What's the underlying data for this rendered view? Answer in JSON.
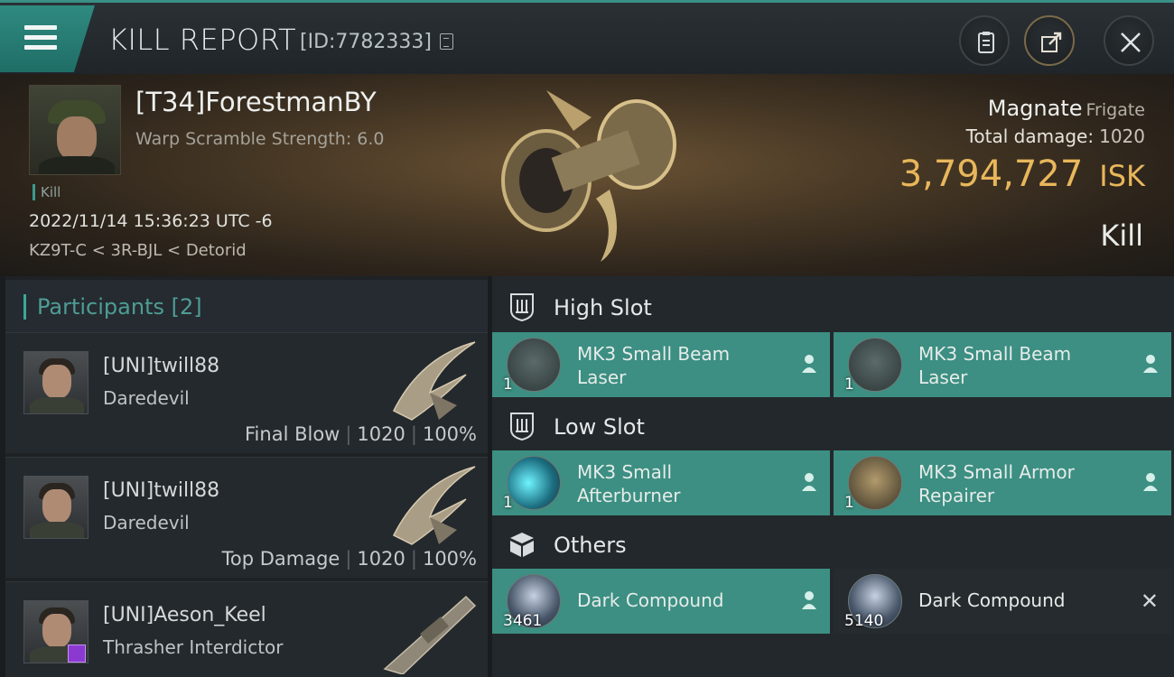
{
  "header": {
    "title": "KILL REPORT",
    "report_id": "[ID:7782333]",
    "icons": [
      "menu-icon",
      "copy-icon",
      "clipboard-icon",
      "share-icon",
      "close-icon"
    ]
  },
  "victim": {
    "name": "[T34]ForestmanBY",
    "warp_scramble": "Warp Scramble Strength: 6.0",
    "tag": "Kill",
    "datetime": "2022/11/14 15:36:23 UTC -6",
    "location": "KZ9T-C < 3R-BJL < Detorid",
    "ship_name": "Magnate",
    "ship_class": "Frigate",
    "total_damage_label": "Total damage:",
    "total_damage": "1020",
    "isk_value": "3,794,727",
    "isk_unit": "ISK",
    "result": "Kill"
  },
  "participants": {
    "header": "Participants [2]",
    "rows": [
      {
        "name": "[UNI]twill88",
        "ship": "Daredevil",
        "role": "Final Blow",
        "damage": "1020",
        "percent": "100%"
      },
      {
        "name": "[UNI]twill88",
        "ship": "Daredevil",
        "role": "Top Damage",
        "damage": "1020",
        "percent": "100%"
      },
      {
        "name": "[UNI]Aeson_Keel",
        "ship": "Thrasher Interdictor"
      }
    ]
  },
  "slots": {
    "high": {
      "label": "High Slot",
      "items": [
        {
          "name_line1": "MK3 Small Beam",
          "name_line2": "Laser",
          "qty": "1"
        },
        {
          "name_line1": "MK3 Small Beam",
          "name_line2": "Laser",
          "qty": "1"
        }
      ]
    },
    "low": {
      "label": "Low Slot",
      "items": [
        {
          "name_line1": "MK3 Small",
          "name_line2": "Afterburner",
          "qty": "1"
        },
        {
          "name_line1": "MK3 Small Armor",
          "name_line2": "Repairer",
          "qty": "1"
        }
      ]
    },
    "others": {
      "label": "Others",
      "items": [
        {
          "name_line1": "Dark Compound",
          "qty": "3461"
        },
        {
          "name_line1": "Dark Compound",
          "qty": "5140"
        }
      ]
    }
  },
  "colors": {
    "accent_teal": "#3c8f82",
    "isk_gold": "#e8b75b",
    "participants_header": "#4e9d95"
  }
}
